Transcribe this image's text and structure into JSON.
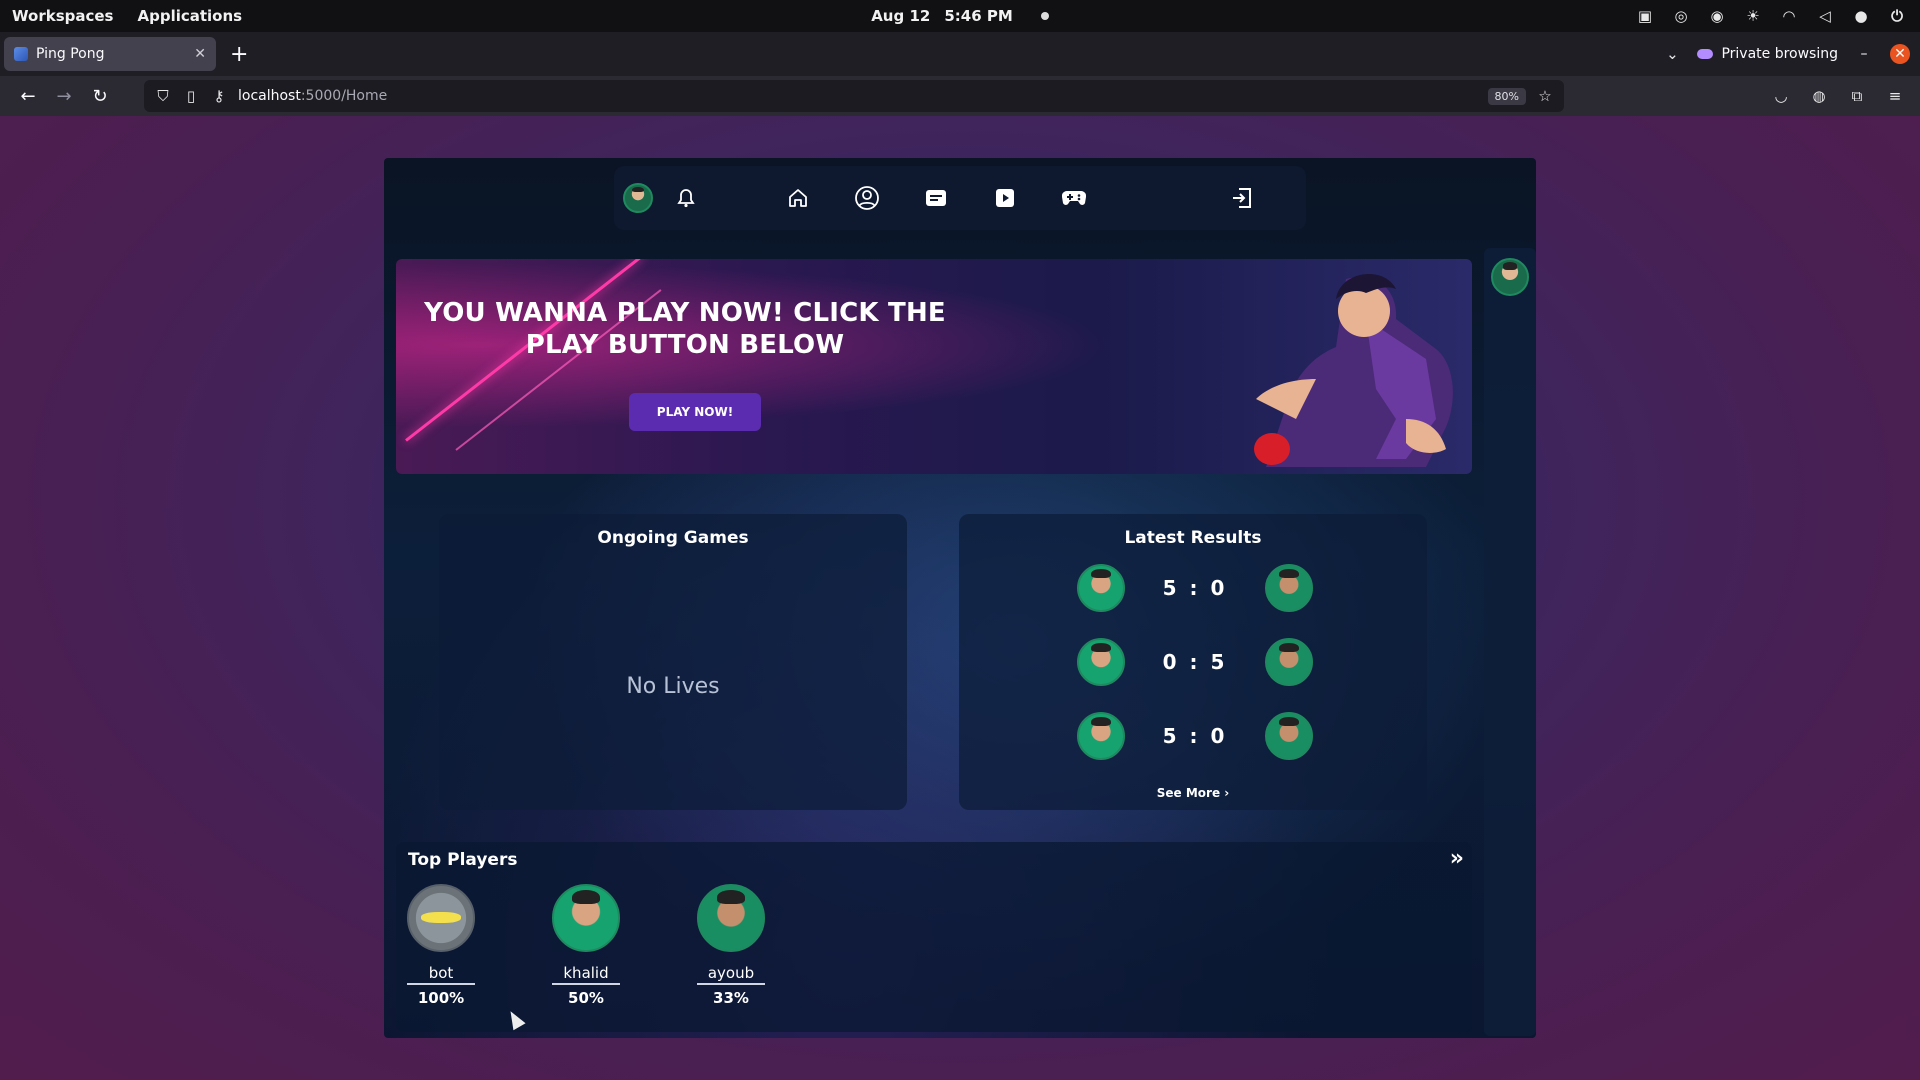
{
  "os": {
    "workspaces": "Workspaces",
    "applications": "Applications",
    "date": "Aug 12",
    "time": "5:46 PM"
  },
  "browser": {
    "tab_title": "Ping Pong",
    "private_label": "Private browsing",
    "url_host": "localhost",
    "url_path": ":5000/Home",
    "zoom": "80%"
  },
  "app": {
    "banner": {
      "headline": "YOU WANNA PLAY NOW! CLICK THE PLAY BUTTON BELOW",
      "play_button": "PLAY NOW!"
    },
    "ongoing": {
      "title": "Ongoing Games",
      "empty": "No Lives"
    },
    "latest": {
      "title": "Latest Results",
      "results": [
        {
          "score": "5 : 0"
        },
        {
          "score": "0 : 5"
        },
        {
          "score": "5 : 0"
        }
      ],
      "see_more": "See More"
    },
    "top_players": {
      "title": "Top Players",
      "players": [
        {
          "name": "bot",
          "pct": "100%"
        },
        {
          "name": "khalid",
          "pct": "50%"
        },
        {
          "name": "ayoub",
          "pct": "33%"
        }
      ]
    }
  },
  "icons": {
    "nav": [
      "bell-icon",
      "home-icon",
      "profile-icon",
      "chat-icon",
      "video-icon",
      "gamepad-icon",
      "logout-icon"
    ]
  },
  "colors": {
    "accent": "#5b2bb0",
    "brand_pink": "#ff3aa8"
  }
}
